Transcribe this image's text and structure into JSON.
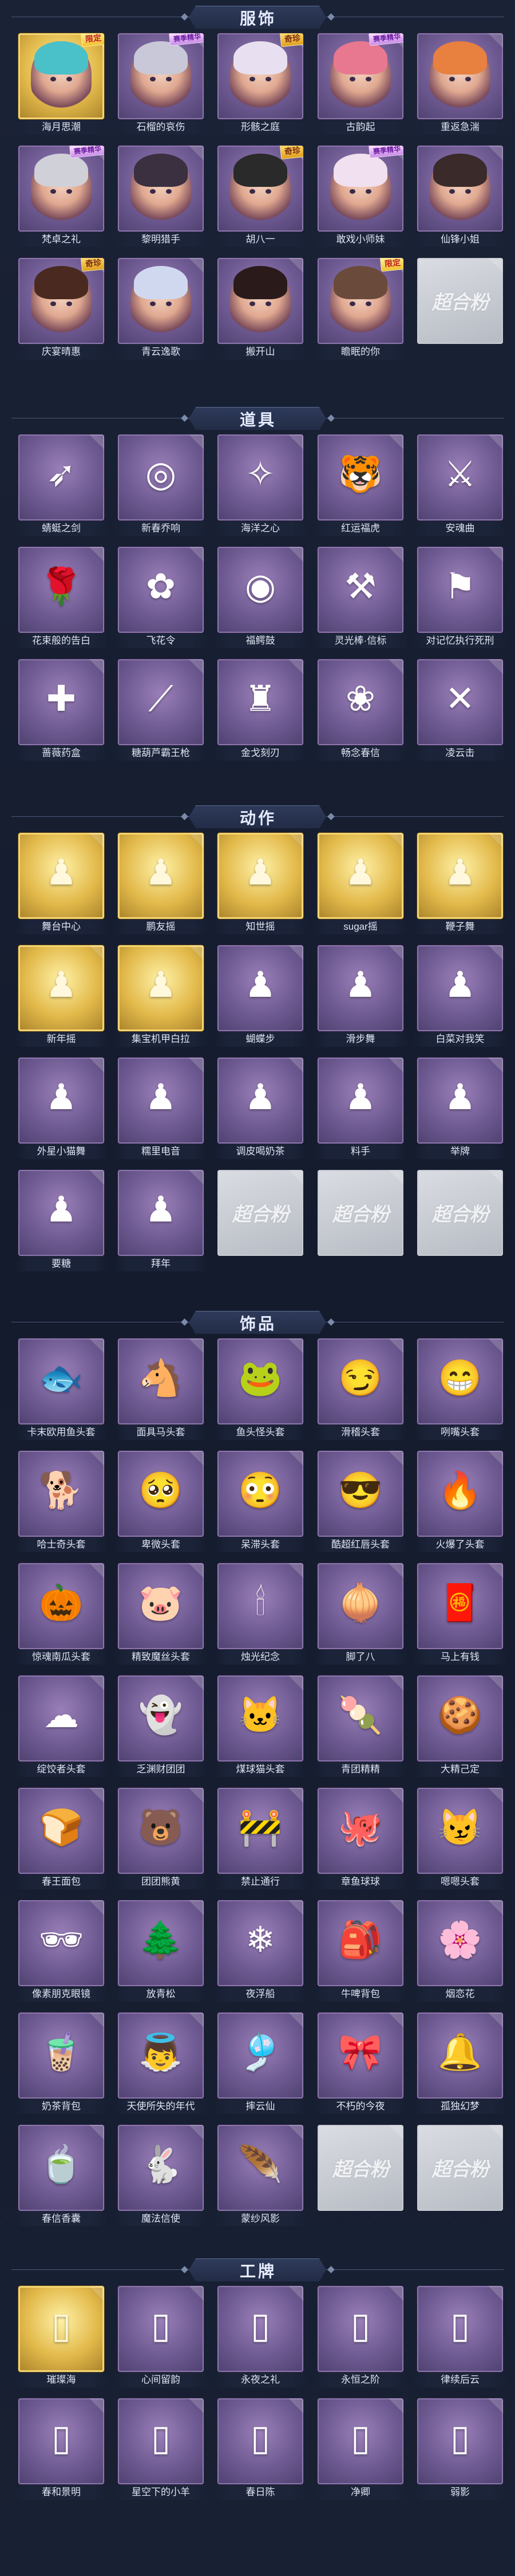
{
  "sections": [
    {
      "title": "服饰",
      "items": [
        {
          "label": "海月思潮",
          "style": "gold",
          "glyph": "✦",
          "badge": "限定",
          "badge_type": "limited",
          "portrait": true,
          "hair": "#4ac0c8"
        },
        {
          "label": "石榴的哀伤",
          "style": "purple",
          "glyph": "✦",
          "badge": "赛季精华",
          "badge_type": "season",
          "portrait": true,
          "hair": "#c8c8d8"
        },
        {
          "label": "形骸之庭",
          "style": "purple",
          "glyph": "✦",
          "badge": "奇珍",
          "badge_type": "normal",
          "portrait": true,
          "hair": "#e8e0f0"
        },
        {
          "label": "古韵起",
          "style": "purple",
          "glyph": "✦",
          "badge": "赛季精华",
          "badge_type": "season",
          "portrait": true,
          "hair": "#e87890"
        },
        {
          "label": "重返急湍",
          "style": "purple",
          "glyph": "✦",
          "badge": "",
          "badge_type": "",
          "portrait": true,
          "hair": "#e88040"
        },
        {
          "label": "梵卓之礼",
          "style": "purple",
          "glyph": "✦",
          "badge": "赛季精华",
          "badge_type": "season",
          "portrait": true,
          "hair": "#d0d0d8"
        },
        {
          "label": "黎明猎手",
          "style": "purple",
          "glyph": "✦",
          "badge": "",
          "badge_type": "",
          "portrait": true,
          "hair": "#3a3040"
        },
        {
          "label": "胡八一",
          "style": "purple",
          "glyph": "✦",
          "badge": "奇珍",
          "badge_type": "normal",
          "portrait": true,
          "hair": "#2a2a2a"
        },
        {
          "label": "敢戏小师妹",
          "style": "purple",
          "glyph": "✦",
          "badge": "赛季精华",
          "badge_type": "season",
          "portrait": true,
          "hair": "#f0e0f0"
        },
        {
          "label": "仙锋小姐",
          "style": "purple",
          "glyph": "✦",
          "badge": "",
          "badge_type": "",
          "portrait": true,
          "hair": "#3a2a2a"
        },
        {
          "label": "庆宴晴惠",
          "style": "purple",
          "glyph": "✦",
          "badge": "奇珍",
          "badge_type": "normal",
          "portrait": true,
          "hair": "#4a2a20"
        },
        {
          "label": "青云逸歌",
          "style": "purple",
          "glyph": "✦",
          "badge": "",
          "badge_type": "",
          "portrait": true,
          "hair": "#d0d8f0"
        },
        {
          "label": "搬开山",
          "style": "purple",
          "glyph": "✦",
          "badge": "",
          "badge_type": "",
          "portrait": true,
          "hair": "#2a1a1a"
        },
        {
          "label": "瞻眠的你",
          "style": "purple",
          "glyph": "✦",
          "badge": "限定",
          "badge_type": "limited",
          "portrait": true,
          "hair": "#6a4a3a"
        },
        {
          "label": "",
          "style": "empty",
          "glyph": "",
          "badge": "",
          "badge_type": "",
          "portrait": false,
          "empty_mark": "超合粉"
        }
      ]
    },
    {
      "title": "道具",
      "items": [
        {
          "label": "蜻蜓之剑",
          "style": "purple",
          "glyph": "➶",
          "badge": "",
          "badge_type": "",
          "portrait": false
        },
        {
          "label": "新春乔响",
          "style": "purple",
          "glyph": "◎",
          "badge": "",
          "badge_type": "",
          "portrait": false
        },
        {
          "label": "海洋之心",
          "style": "purple",
          "glyph": "✧",
          "badge": "",
          "badge_type": "",
          "portrait": false
        },
        {
          "label": "红运福虎",
          "style": "purple",
          "glyph": "🐯",
          "badge": "",
          "badge_type": "",
          "portrait": false
        },
        {
          "label": "安魂曲",
          "style": "purple",
          "glyph": "⚔",
          "badge": "",
          "badge_type": "",
          "portrait": false
        },
        {
          "label": "花束般的告白",
          "style": "purple",
          "glyph": "🌹",
          "badge": "",
          "badge_type": "",
          "portrait": false
        },
        {
          "label": "飞花令",
          "style": "purple",
          "glyph": "✿",
          "badge": "",
          "badge_type": "",
          "portrait": false
        },
        {
          "label": "福鳄鼓",
          "style": "purple",
          "glyph": "◉",
          "badge": "",
          "badge_type": "",
          "portrait": false
        },
        {
          "label": "灵光棒·信标",
          "style": "purple",
          "glyph": "⚒",
          "badge": "",
          "badge_type": "",
          "portrait": false
        },
        {
          "label": "对记忆执行死刑",
          "style": "purple",
          "glyph": "⚑",
          "badge": "",
          "badge_type": "",
          "portrait": false
        },
        {
          "label": "蔷薇药盒",
          "style": "purple",
          "glyph": "✚",
          "badge": "",
          "badge_type": "",
          "portrait": false
        },
        {
          "label": "糖葫芦霸王枪",
          "style": "purple",
          "glyph": "⟋",
          "badge": "",
          "badge_type": "",
          "portrait": false
        },
        {
          "label": "金戈刻刃",
          "style": "purple",
          "glyph": "♜",
          "badge": "",
          "badge_type": "",
          "portrait": false
        },
        {
          "label": "畅念春信",
          "style": "purple",
          "glyph": "❀",
          "badge": "",
          "badge_type": "",
          "portrait": false
        },
        {
          "label": "凌云击",
          "style": "purple",
          "glyph": "✕",
          "badge": "",
          "badge_type": "",
          "portrait": false
        }
      ]
    },
    {
      "title": "动作",
      "items": [
        {
          "label": "舞台中心",
          "style": "gold",
          "glyph": "♟",
          "badge": "",
          "badge_type": "",
          "portrait": false
        },
        {
          "label": "鹏友摇",
          "style": "gold",
          "glyph": "♟",
          "badge": "",
          "badge_type": "",
          "portrait": false
        },
        {
          "label": "知世摇",
          "style": "gold",
          "glyph": "♟",
          "badge": "",
          "badge_type": "",
          "portrait": false
        },
        {
          "label": "sugar摇",
          "style": "gold",
          "glyph": "♟",
          "badge": "",
          "badge_type": "",
          "portrait": false
        },
        {
          "label": "鞭子舞",
          "style": "gold",
          "glyph": "♟",
          "badge": "",
          "badge_type": "",
          "portrait": false
        },
        {
          "label": "新年摇",
          "style": "gold",
          "glyph": "♟",
          "badge": "",
          "badge_type": "",
          "portrait": false
        },
        {
          "label": "集宝机甲白拉",
          "style": "gold",
          "glyph": "♟",
          "badge": "",
          "badge_type": "",
          "portrait": false
        },
        {
          "label": "蝴蝶步",
          "style": "purple",
          "glyph": "♟",
          "badge": "",
          "badge_type": "",
          "portrait": false
        },
        {
          "label": "滑步舞",
          "style": "purple",
          "glyph": "♟",
          "badge": "",
          "badge_type": "",
          "portrait": false
        },
        {
          "label": "白菜对我笑",
          "style": "purple",
          "glyph": "♟",
          "badge": "",
          "badge_type": "",
          "portrait": false
        },
        {
          "label": "外星小猫舞",
          "style": "purple",
          "glyph": "♟",
          "badge": "",
          "badge_type": "",
          "portrait": false
        },
        {
          "label": "糯里电音",
          "style": "purple",
          "glyph": "♟",
          "badge": "",
          "badge_type": "",
          "portrait": false
        },
        {
          "label": "调皮喝奶茶",
          "style": "purple",
          "glyph": "♟",
          "badge": "",
          "badge_type": "",
          "portrait": false
        },
        {
          "label": "料手",
          "style": "purple",
          "glyph": "♟",
          "badge": "",
          "badge_type": "",
          "portrait": false
        },
        {
          "label": "举牌",
          "style": "purple",
          "glyph": "♟",
          "badge": "",
          "badge_type": "",
          "portrait": false
        },
        {
          "label": "要糖",
          "style": "purple",
          "glyph": "♟",
          "badge": "",
          "badge_type": "",
          "portrait": false
        },
        {
          "label": "拜年",
          "style": "purple",
          "glyph": "♟",
          "badge": "",
          "badge_type": "",
          "portrait": false
        },
        {
          "label": "",
          "style": "empty",
          "glyph": "",
          "badge": "",
          "badge_type": "",
          "portrait": false,
          "empty_mark": "超合粉"
        },
        {
          "label": "",
          "style": "empty",
          "glyph": "",
          "badge": "",
          "badge_type": "",
          "portrait": false,
          "empty_mark": "超合粉"
        },
        {
          "label": "",
          "style": "empty",
          "glyph": "",
          "badge": "",
          "badge_type": "",
          "portrait": false,
          "empty_mark": "超合粉"
        }
      ]
    },
    {
      "title": "饰品",
      "items": [
        {
          "label": "卡末欧用鱼头套",
          "style": "purple",
          "glyph": "🐟",
          "badge": "",
          "badge_type": "",
          "portrait": false
        },
        {
          "label": "面具马头套",
          "style": "purple",
          "glyph": "🐴",
          "badge": "",
          "badge_type": "",
          "portrait": false
        },
        {
          "label": "鱼头怪头套",
          "style": "purple",
          "glyph": "🐸",
          "badge": "",
          "badge_type": "",
          "portrait": false
        },
        {
          "label": "滑稽头套",
          "style": "purple",
          "glyph": "😏",
          "badge": "",
          "badge_type": "",
          "portrait": false
        },
        {
          "label": "咧嘴头套",
          "style": "purple",
          "glyph": "😁",
          "badge": "",
          "badge_type": "",
          "portrait": false
        },
        {
          "label": "哈士奇头套",
          "style": "purple",
          "glyph": "🐕",
          "badge": "",
          "badge_type": "",
          "portrait": false
        },
        {
          "label": "卑微头套",
          "style": "purple",
          "glyph": "🥺",
          "badge": "",
          "badge_type": "",
          "portrait": false
        },
        {
          "label": "呆滞头套",
          "style": "purple",
          "glyph": "😳",
          "badge": "",
          "badge_type": "",
          "portrait": false
        },
        {
          "label": "酷超红唇头套",
          "style": "purple",
          "glyph": "😎",
          "badge": "",
          "badge_type": "",
          "portrait": false
        },
        {
          "label": "火爆了头套",
          "style": "purple",
          "glyph": "🔥",
          "badge": "",
          "badge_type": "",
          "portrait": false
        },
        {
          "label": "惊魂南瓜头套",
          "style": "purple",
          "glyph": "🎃",
          "badge": "",
          "badge_type": "",
          "portrait": false
        },
        {
          "label": "精致魔丝头套",
          "style": "purple",
          "glyph": "🐷",
          "badge": "",
          "badge_type": "",
          "portrait": false
        },
        {
          "label": "烛光纪念",
          "style": "purple",
          "glyph": "🕯",
          "badge": "",
          "badge_type": "",
          "portrait": false
        },
        {
          "label": "脚了八",
          "style": "purple",
          "glyph": "🧅",
          "badge": "",
          "badge_type": "",
          "portrait": false
        },
        {
          "label": "马上有钱",
          "style": "purple",
          "glyph": "🧧",
          "badge": "",
          "badge_type": "",
          "portrait": false
        },
        {
          "label": "绽饺者头套",
          "style": "purple",
          "glyph": "☁",
          "badge": "",
          "badge_type": "",
          "portrait": false
        },
        {
          "label": "乏渊财团团",
          "style": "purple",
          "glyph": "👻",
          "badge": "",
          "badge_type": "",
          "portrait": false
        },
        {
          "label": "煤球猫头套",
          "style": "purple",
          "glyph": "🐱",
          "badge": "",
          "badge_type": "",
          "portrait": false
        },
        {
          "label": "青团精精",
          "style": "purple",
          "glyph": "🍡",
          "badge": "",
          "badge_type": "",
          "portrait": false
        },
        {
          "label": "大精己定",
          "style": "purple",
          "glyph": "🍪",
          "badge": "",
          "badge_type": "",
          "portrait": false
        },
        {
          "label": "春王面包",
          "style": "purple",
          "glyph": "🍞",
          "badge": "",
          "badge_type": "",
          "portrait": false
        },
        {
          "label": "团团熊黄",
          "style": "purple",
          "glyph": "🐻",
          "badge": "",
          "badge_type": "",
          "portrait": false
        },
        {
          "label": "禁止通行",
          "style": "purple",
          "glyph": "🚧",
          "badge": "",
          "badge_type": "",
          "portrait": false
        },
        {
          "label": "章鱼球球",
          "style": "purple",
          "glyph": "🐙",
          "badge": "",
          "badge_type": "",
          "portrait": false
        },
        {
          "label": "嗯嗯头套",
          "style": "purple",
          "glyph": "😼",
          "badge": "",
          "badge_type": "",
          "portrait": false
        },
        {
          "label": "像素朋克眼镜",
          "style": "purple",
          "glyph": "🕶",
          "badge": "",
          "badge_type": "",
          "portrait": false
        },
        {
          "label": "放青松",
          "style": "purple",
          "glyph": "🌲",
          "badge": "",
          "badge_type": "",
          "portrait": false
        },
        {
          "label": "夜浮船",
          "style": "purple",
          "glyph": "❄",
          "badge": "",
          "badge_type": "",
          "portrait": false
        },
        {
          "label": "牛啤背包",
          "style": "purple",
          "glyph": "🎒",
          "badge": "",
          "badge_type": "",
          "portrait": false
        },
        {
          "label": "烟恋花",
          "style": "purple",
          "glyph": "🌸",
          "badge": "",
          "badge_type": "",
          "portrait": false
        },
        {
          "label": "奶茶背包",
          "style": "purple",
          "glyph": "🧋",
          "badge": "",
          "badge_type": "",
          "portrait": false
        },
        {
          "label": "天使所失的年代",
          "style": "purple",
          "glyph": "👼",
          "badge": "",
          "badge_type": "",
          "portrait": false
        },
        {
          "label": "摔云仙",
          "style": "purple",
          "glyph": "🎐",
          "badge": "",
          "badge_type": "",
          "portrait": false
        },
        {
          "label": "不朽的今夜",
          "style": "purple",
          "glyph": "🎀",
          "badge": "",
          "badge_type": "",
          "portrait": false
        },
        {
          "label": "孤独幻梦",
          "style": "purple",
          "glyph": "🔔",
          "badge": "",
          "badge_type": "",
          "portrait": false
        },
        {
          "label": "春信香囊",
          "style": "purple",
          "glyph": "🍵",
          "badge": "",
          "badge_type": "",
          "portrait": false
        },
        {
          "label": "魔法信使",
          "style": "purple",
          "glyph": "🐇",
          "badge": "",
          "badge_type": "",
          "portrait": false
        },
        {
          "label": "蒙纱风影",
          "style": "purple",
          "glyph": "🪶",
          "badge": "",
          "badge_type": "",
          "portrait": false
        },
        {
          "label": "",
          "style": "empty",
          "glyph": "",
          "badge": "",
          "badge_type": "",
          "portrait": false,
          "empty_mark": "超合粉"
        },
        {
          "label": "",
          "style": "empty",
          "glyph": "",
          "badge": "",
          "badge_type": "",
          "portrait": false,
          "empty_mark": "超合粉"
        }
      ]
    },
    {
      "title": "工牌",
      "items": [
        {
          "label": "璀璨海",
          "style": "gold",
          "glyph": "▯",
          "badge": "",
          "badge_type": "",
          "portrait": false
        },
        {
          "label": "心间留韵",
          "style": "purple",
          "glyph": "▯",
          "badge": "",
          "badge_type": "",
          "portrait": false
        },
        {
          "label": "永夜之礼",
          "style": "purple",
          "glyph": "▯",
          "badge": "",
          "badge_type": "",
          "portrait": false
        },
        {
          "label": "永恒之阶",
          "style": "purple",
          "glyph": "▯",
          "badge": "",
          "badge_type": "",
          "portrait": false
        },
        {
          "label": "律续后云",
          "style": "purple",
          "glyph": "▯",
          "badge": "",
          "badge_type": "",
          "portrait": false
        },
        {
          "label": "春和景明",
          "style": "purple",
          "glyph": "▯",
          "badge": "",
          "badge_type": "",
          "portrait": false
        },
        {
          "label": "星空下的小羊",
          "style": "purple",
          "glyph": "▯",
          "badge": "",
          "badge_type": "",
          "portrait": false
        },
        {
          "label": "春日陈",
          "style": "purple",
          "glyph": "▯",
          "badge": "",
          "badge_type": "",
          "portrait": false
        },
        {
          "label": "净卿",
          "style": "purple",
          "glyph": "▯",
          "badge": "",
          "badge_type": "",
          "portrait": false
        },
        {
          "label": "弱影",
          "style": "purple",
          "glyph": "▯",
          "badge": "",
          "badge_type": "",
          "portrait": false
        }
      ]
    }
  ]
}
